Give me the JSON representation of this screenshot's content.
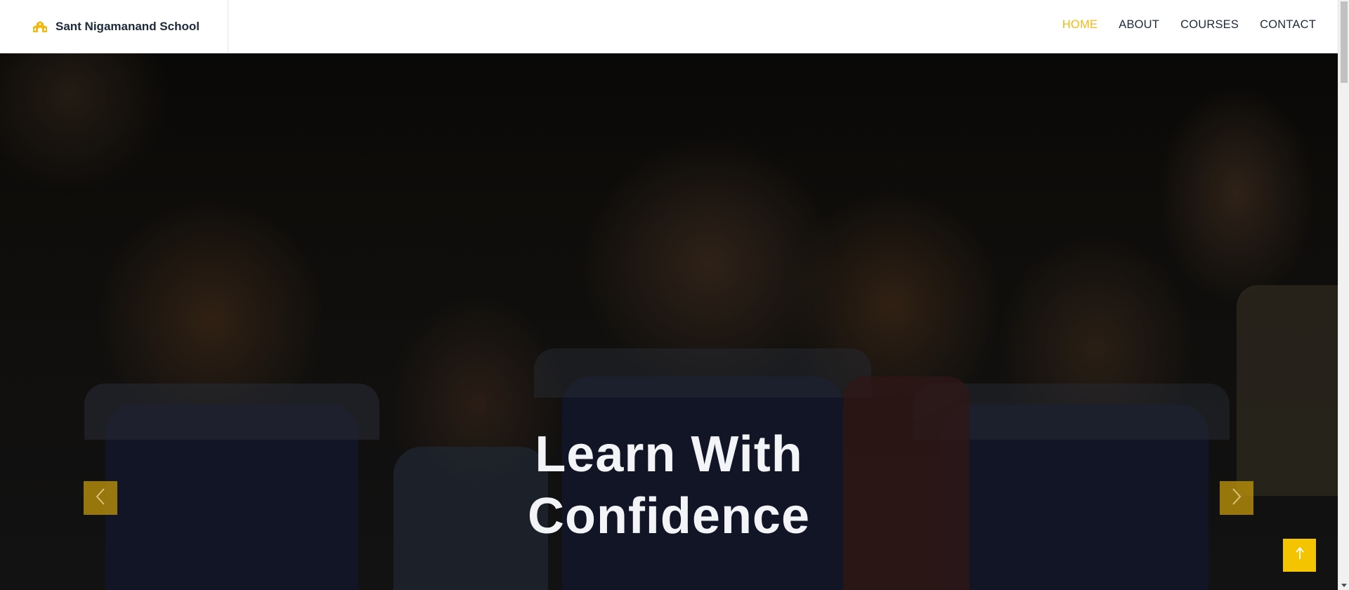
{
  "header": {
    "brand_name": "Sant Nigamanand School",
    "brand_icon": "school-icon",
    "accent_color": "#f0b913"
  },
  "nav": {
    "items": [
      {
        "label": "HOME",
        "active": true
      },
      {
        "label": "ABOUT",
        "active": false
      },
      {
        "label": "COURSES",
        "active": false
      },
      {
        "label": "CONTACT",
        "active": false
      }
    ]
  },
  "hero": {
    "title_line1": "Learn With",
    "title_line2": "Confidence",
    "prev_icon": "chevron-left-icon",
    "next_icon": "chevron-right-icon"
  },
  "back_to_top": {
    "icon": "arrow-up-icon",
    "color": "#f5c400"
  }
}
